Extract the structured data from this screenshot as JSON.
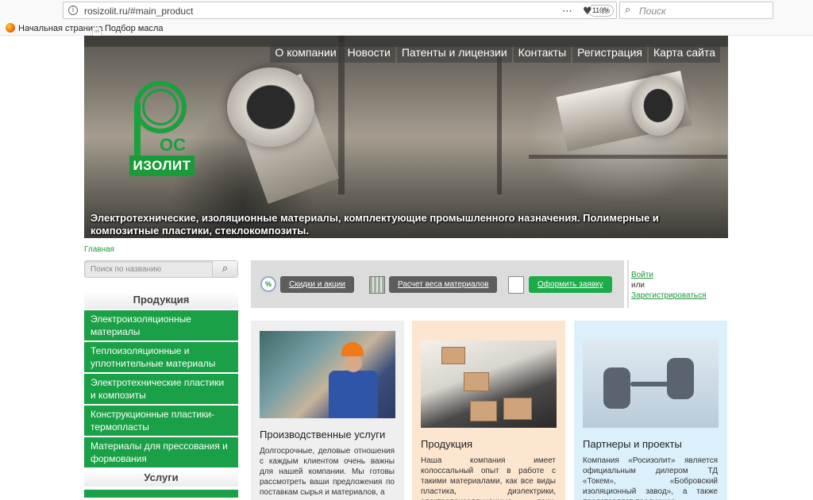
{
  "browser": {
    "url": "rosizolit.ru/#main_product",
    "zoom": "110%",
    "search_placeholder": "Поиск",
    "bookmarks": [
      "Начальная страница",
      "Подбор масла"
    ]
  },
  "header": {
    "nav": [
      "О компании",
      "Новости",
      "Патенты и лицензии",
      "Контакты",
      "Регистрация",
      "Карта сайта"
    ],
    "logo_suffix": "ОС",
    "logo_name": "ИЗОЛИТ",
    "tagline": "Электротехнические, изоляционные материалы, комплектующие промышленного назначения. Полимерные и композитные пластики, стеклокомпозиты."
  },
  "breadcrumb": "Главная",
  "sidebar": {
    "search_placeholder": "Поиск по названию",
    "products_title": "Продукция",
    "products": [
      "Электроизоляционные материалы",
      "Теплоизоляционные и уплотнительные материалы",
      "Электротехнические пластики и композиты",
      "Конструкционные пластики-термопласты",
      "Материалы для прессования и формования"
    ],
    "services_title": "Услуги"
  },
  "toolbar": {
    "discounts": "Скидки и акции",
    "weight": "Расчет веса материалов",
    "order": "Оформить заявку",
    "login": "Войти",
    "or": "или",
    "register": "Зарегистрироваться"
  },
  "cards": [
    {
      "title": "Производственные услуги",
      "text": "Долгосрочные, деловые отношения с каждым клиентом очень важны для нашей компании. Мы готовы рассмотреть ваши предложения по поставкам сырья и материалов, а"
    },
    {
      "title": "Продукция",
      "text": "Наша компания имеет колоссальный опыт в работе с такими материалами, как все виды пластика, диэлектрики, электропоизоляционные лаки, эмали и"
    },
    {
      "title": "Партнеры и проекты",
      "text": "Компания «Росизолит» является официальным дилером ТД «Токем», «Бобровский изоляционный завод», а также представляет продукцию"
    }
  ]
}
